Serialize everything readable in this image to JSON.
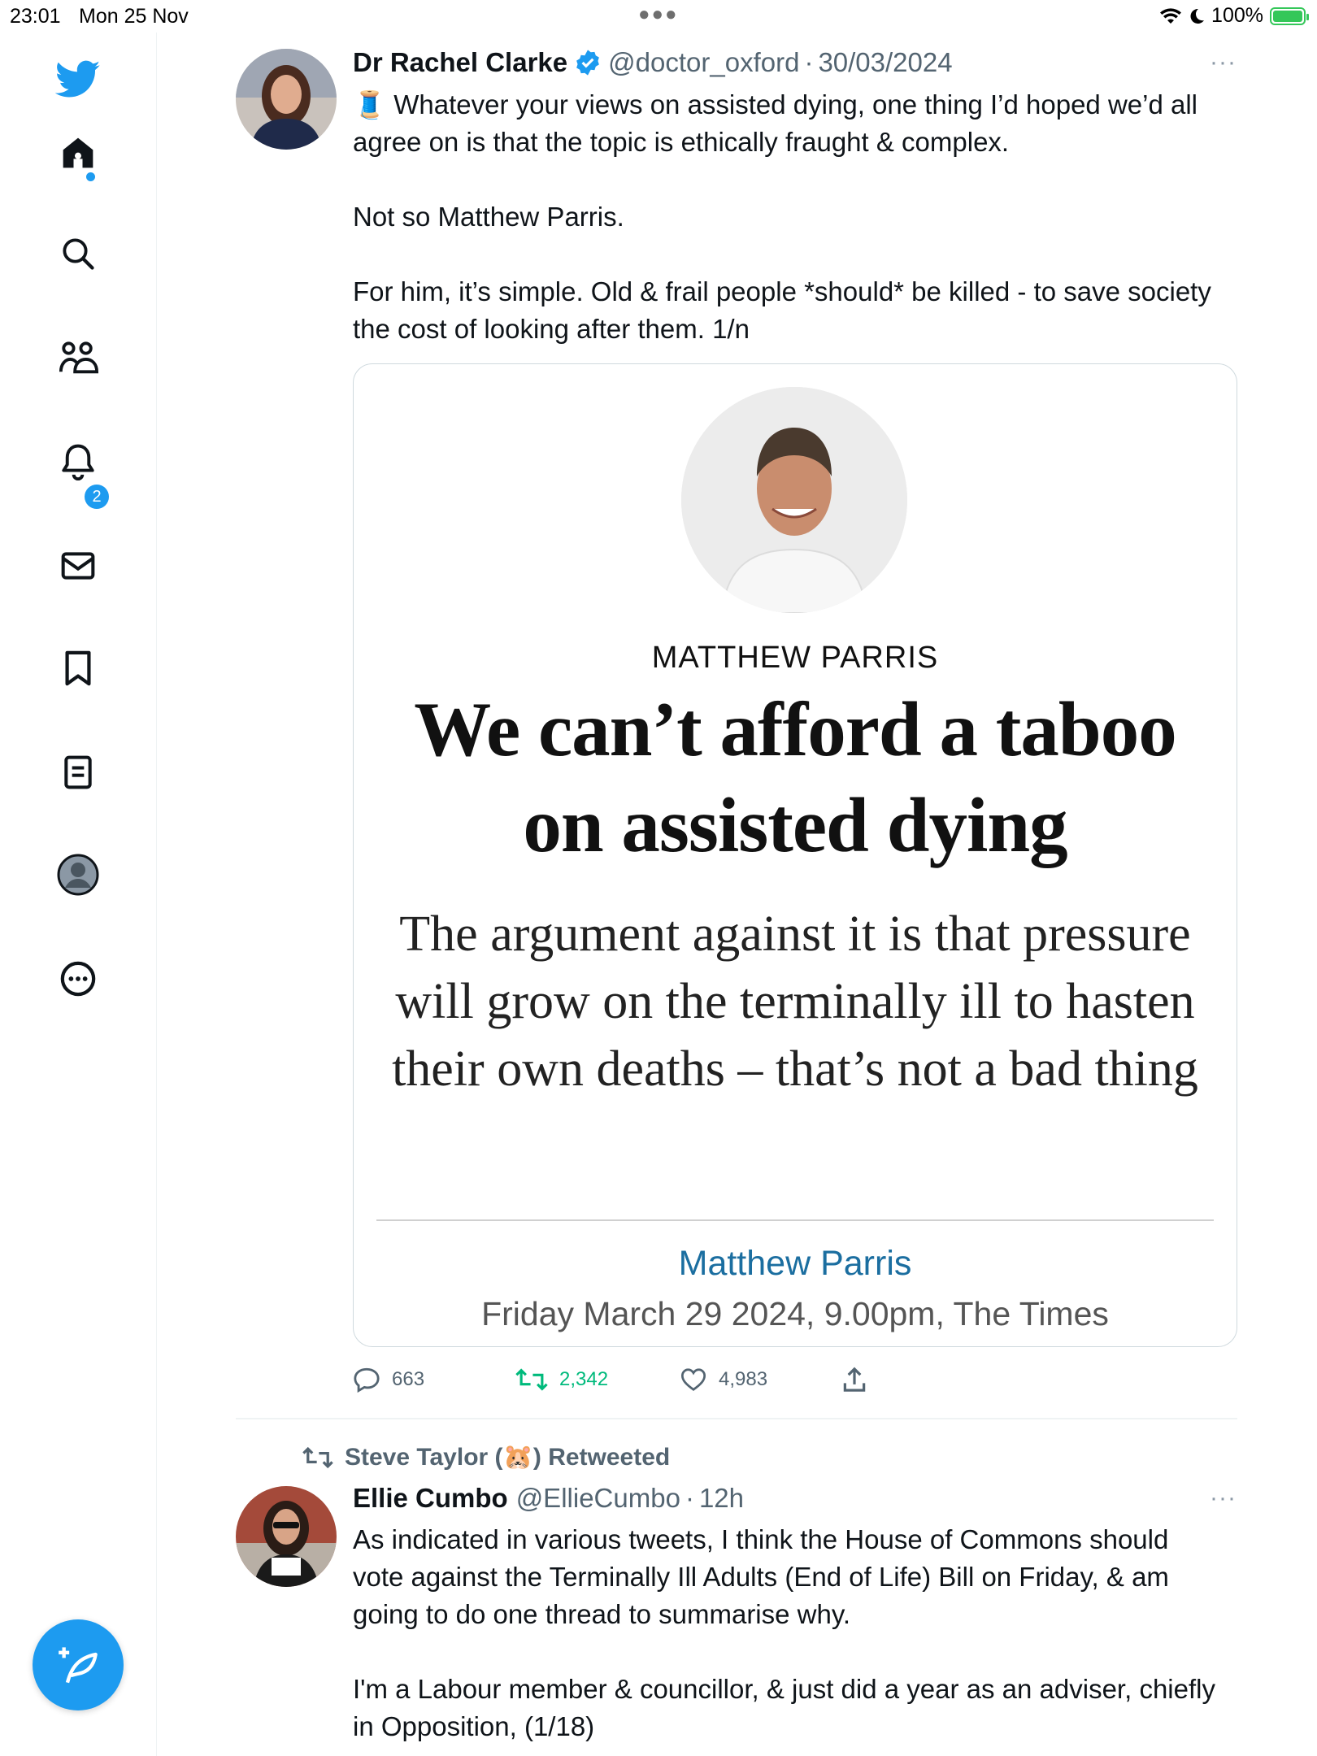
{
  "status_bar": {
    "time": "23:01",
    "date": "Mon 25 Nov",
    "battery": "100%"
  },
  "sidebar": {
    "items": [
      {
        "name": "home",
        "icon": "home-icon"
      },
      {
        "name": "explore",
        "icon": "search-icon"
      },
      {
        "name": "communities",
        "icon": "people-icon"
      },
      {
        "name": "notifications",
        "icon": "bell-icon",
        "badge": "2"
      },
      {
        "name": "messages",
        "icon": "mail-icon"
      },
      {
        "name": "bookmarks",
        "icon": "bookmark-icon"
      },
      {
        "name": "lists",
        "icon": "list-icon"
      },
      {
        "name": "profile",
        "icon": "avatar-icon"
      },
      {
        "name": "more",
        "icon": "more-circle-icon"
      }
    ],
    "accent_color": "#1d9bf0"
  },
  "tweet1": {
    "name": "Dr Rachel Clarke",
    "handle": "@doctor_oxford",
    "separator": "·",
    "date": "30/03/2024",
    "emoji": "🧵",
    "paragraphs": [
      "Whatever your views on assisted dying, one thing I’d hoped we’d all agree on is that the topic is ethically fraught & complex.",
      "Not so Matthew Parris.",
      "For him, it’s simple. Old & frail people *should* be killed - to save society the cost of looking after them. 1/n"
    ],
    "card": {
      "kicker": "MATTHEW PARRIS",
      "headline": "We can’t afford a taboo on assisted dying",
      "standfirst": "The argument against it is that pressure will grow on the terminally ill to hasten their own deaths – that’s not a bad thing",
      "byline": "Matthew Parris",
      "dateline": "Friday March 29 2024, 9.00pm, The Times"
    },
    "actions": {
      "replies": "663",
      "retweets": "2,342",
      "likes": "4,983"
    },
    "retweet_color": "#00ba7c"
  },
  "tweet2": {
    "retweeted_by": "Steve Taylor (🐹) Retweeted",
    "name": "Ellie Cumbo",
    "handle": "@EllieCumbo",
    "separator": "·",
    "time": "12h",
    "paragraphs": [
      "As indicated in various tweets, I think the House of Commons should vote against the Terminally Ill Adults (End of Life) Bill on Friday, & am going to do one thread to summarise why.",
      "I'm a Labour member & councillor, & just did a year as an adviser, chiefly in Opposition, (1/18)"
    ]
  }
}
